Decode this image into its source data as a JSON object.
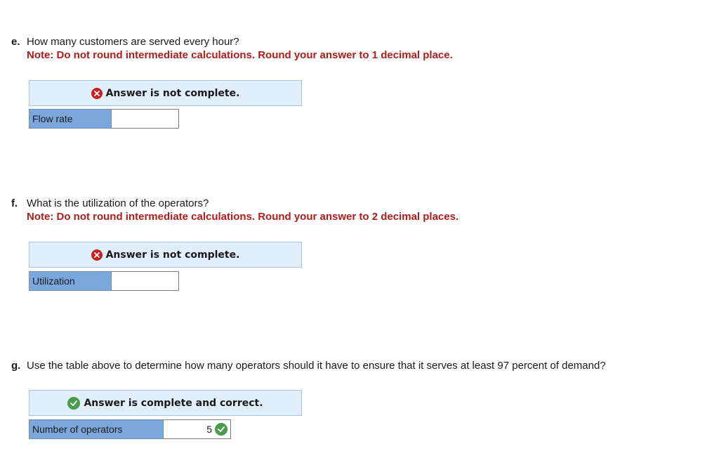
{
  "questions": [
    {
      "letter": "e.",
      "text": "How many customers are served every hour?",
      "note": "Note: Do not round intermediate calculations. Round your answer to 1 decimal place.",
      "status": "Answer is not complete.",
      "status_icon": "x-circle-icon",
      "field_label": "Flow rate",
      "field_value": ""
    },
    {
      "letter": "f.",
      "text": "What is the utilization of the operators?",
      "note": "Note: Do not round intermediate calculations. Round your answer to 2 decimal places.",
      "status": "Answer is not complete.",
      "status_icon": "x-circle-icon",
      "field_label": "Utilization",
      "field_value": ""
    },
    {
      "letter": "g.",
      "text": "Use the table above to determine how many operators should it have to ensure that it serves at least 97 percent of demand?",
      "status": "Answer is complete and correct.",
      "status_icon": "check-circle-icon",
      "field_label": "Number of operators",
      "field_value": "5",
      "field_icon": "check-circle-icon"
    }
  ],
  "colors": {
    "note_red": "#b01c1c",
    "banner_bg": "#e1eefb",
    "label_bg": "#7ba7dd",
    "error_red": "#c5221f",
    "correct_green": "#4a9b4a"
  }
}
